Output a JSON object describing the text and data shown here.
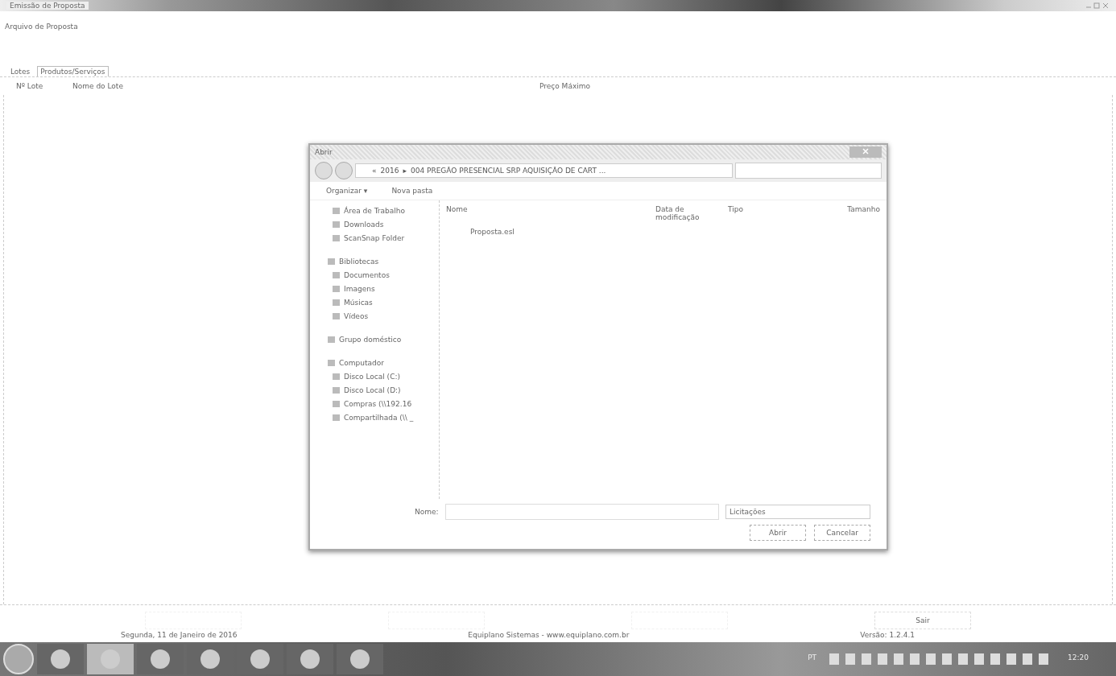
{
  "window": {
    "title": "Emissão de Proposta"
  },
  "menu": [
    "Arquivo de Proposta"
  ],
  "tabs": [
    {
      "label": "Lotes",
      "selected": false
    },
    {
      "label": "Produtos/Serviços",
      "selected": true
    }
  ],
  "table": {
    "columns": [
      "Nº Lote",
      "Nome do Lote",
      "Preço Máximo"
    ]
  },
  "dialog": {
    "title": "Abrir",
    "breadcrumb": [
      "«",
      "2016",
      "▸",
      "004 PREGÃO PRESENCIAL SRP AQUISIÇÃO DE CART ..."
    ],
    "toolbar": [
      "Organizar ▾",
      "Nova pasta"
    ],
    "nav": [
      {
        "label": "Área de Trabalho"
      },
      {
        "label": "Downloads"
      },
      {
        "label": "ScanSnap Folder"
      },
      {
        "label": "Bibliotecas",
        "kind": "group",
        "children": [
          {
            "label": "Documentos"
          },
          {
            "label": "Imagens"
          },
          {
            "label": "Músicas"
          },
          {
            "label": "Vídeos"
          }
        ]
      },
      {
        "label": "Grupo doméstico",
        "kind": "group"
      },
      {
        "label": "Computador",
        "kind": "group",
        "children": [
          {
            "label": "Disco Local (C:)"
          },
          {
            "label": "Disco Local (D:)"
          },
          {
            "label": "Compras (\\\\192.16"
          },
          {
            "label": "Compartilhada (\\\\ _"
          }
        ]
      }
    ],
    "columns": [
      "Nome",
      "Data de modificação",
      "Tipo",
      "Tamanho"
    ],
    "files": [
      {
        "name": "Proposta.esl",
        "selected": false
      }
    ],
    "filename_label": "Nome:",
    "filter": "Licitações",
    "open_button": "Abrir",
    "cancel_button": "Cancelar"
  },
  "footer_buttons": [
    {
      "label": "Sair"
    }
  ],
  "status_bar": {
    "date": "Segunda, 11 de Janeiro de 2016",
    "company": "Equiplano Sistemas - www.equiplano.com.br",
    "version": "Versão: 1.2.4.1"
  },
  "taskbar": {
    "language": "PT",
    "time": "12:20"
  }
}
